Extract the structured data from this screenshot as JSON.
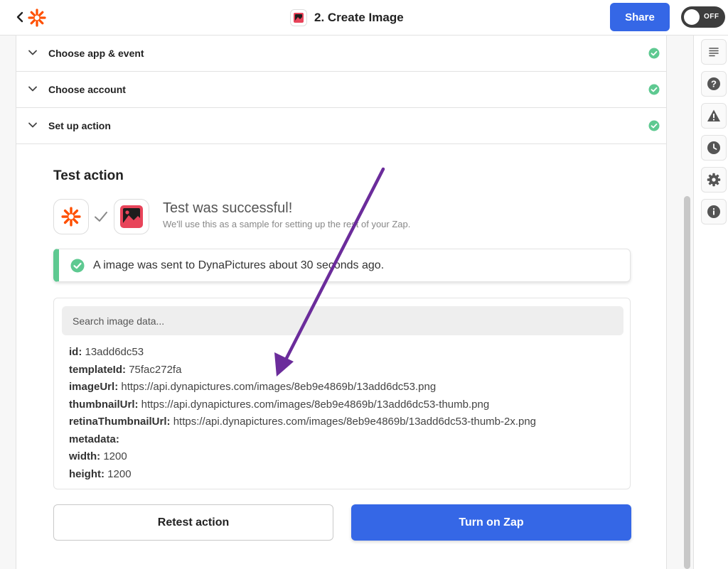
{
  "header": {
    "title": "2. Create Image",
    "share_label": "Share",
    "toggle_label": "OFF"
  },
  "sections": [
    {
      "label": "Choose app & event"
    },
    {
      "label": "Choose account"
    },
    {
      "label": "Set up action"
    }
  ],
  "test": {
    "heading": "Test action",
    "success_title": "Test was successful!",
    "success_subtitle": "We'll use this as a sample for setting up the rest of your Zap.",
    "alert": "A image was sent to DynaPictures about 30 seconds ago.",
    "search_placeholder": "Search image data...",
    "fields": [
      {
        "key": "id:",
        "value": "13add6dc53"
      },
      {
        "key": "templateId:",
        "value": "75fac272fa"
      },
      {
        "key": "imageUrl:",
        "value": "https://api.dynapictures.com/images/8eb9e4869b/13add6dc53.png"
      },
      {
        "key": "thumbnailUrl:",
        "value": "https://api.dynapictures.com/images/8eb9e4869b/13add6dc53-thumb.png"
      },
      {
        "key": "retinaThumbnailUrl:",
        "value": "https://api.dynapictures.com/images/8eb9e4869b/13add6dc53-thumb-2x.png"
      },
      {
        "key": "metadata:",
        "value": ""
      },
      {
        "key": "width:",
        "value": "1200"
      },
      {
        "key": "height:",
        "value": "1200"
      }
    ],
    "retest_label": "Retest action",
    "turn_on_label": "Turn on Zap"
  },
  "colors": {
    "primary": "#3567e6",
    "success": "#5ec991",
    "zapier_orange": "#ff4f00",
    "annotation_arrow": "#6b2c9b",
    "app_icon": "#e8445a"
  },
  "icons": {
    "back": "chevron-left-icon",
    "logo": "zapier-logo-icon",
    "app": "image-app-icon",
    "section_toggle": "chevron-down-icon",
    "section_status": "check-circle-icon",
    "rail": [
      "details-icon",
      "help-icon",
      "warning-icon",
      "history-icon",
      "settings-icon",
      "info-icon"
    ]
  }
}
